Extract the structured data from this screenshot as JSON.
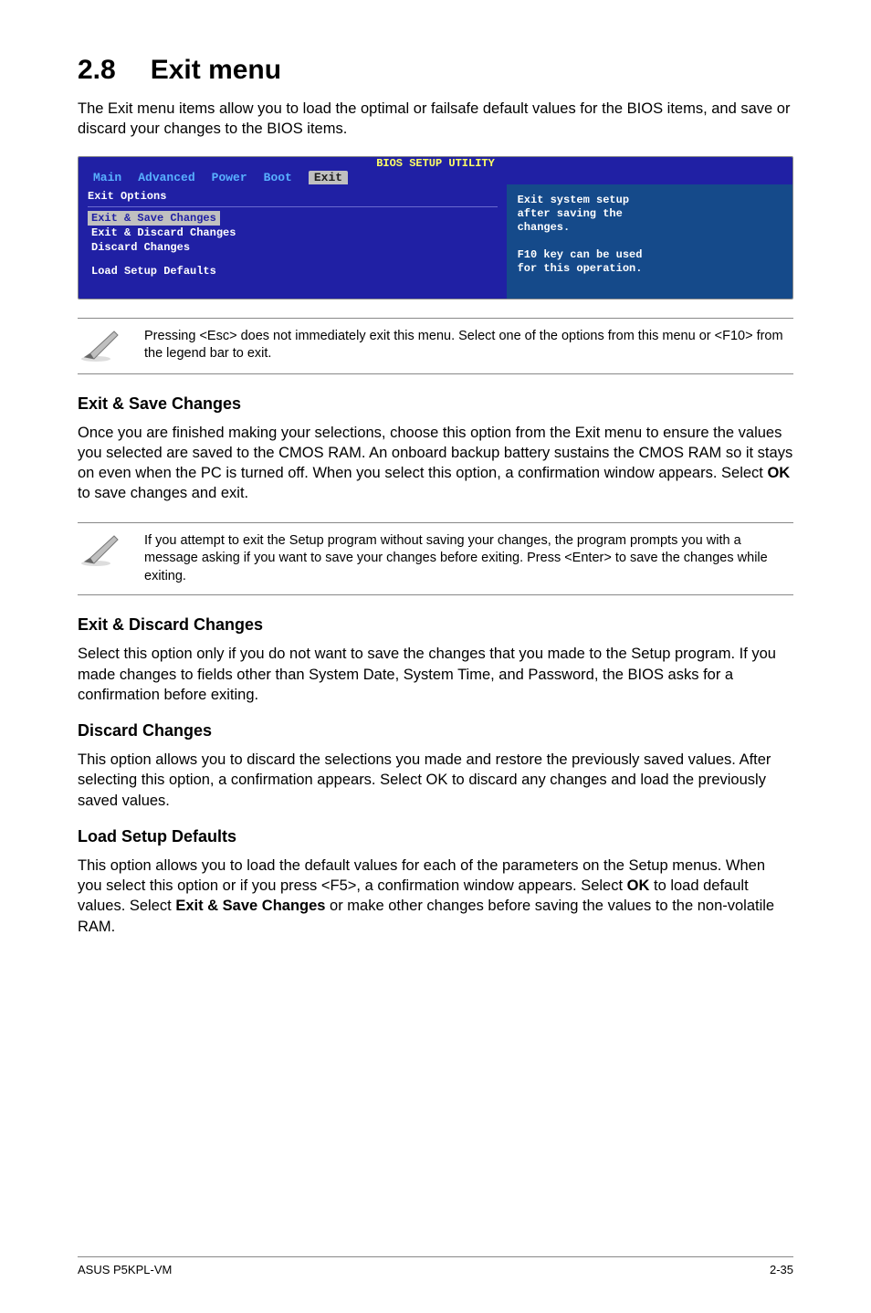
{
  "section_number": "2.8",
  "section_title": "Exit menu",
  "intro": "The Exit menu items allow you to load the optimal or failsafe default values for the BIOS items, and save or discard your changes to the BIOS items.",
  "bios": {
    "header_title": "BIOS SETUP UTILITY",
    "tabs": [
      "Main",
      "Advanced",
      "Power",
      "Boot",
      "Exit"
    ],
    "active_tab_index": 4,
    "left": {
      "group_label": "Exit Options",
      "selected": "Exit & Save Changes",
      "items": [
        "Exit & Discard Changes",
        "Discard Changes"
      ],
      "after_gap_item": "Load Setup Defaults"
    },
    "right_lines": [
      "Exit system setup",
      "after saving the",
      "changes.",
      "",
      "F10 key can be used",
      "for this operation."
    ]
  },
  "note1": "Pressing <Esc> does not immediately exit this menu. Select one of the options from this menu or <F10> from the legend bar to exit.",
  "sections": {
    "exit_save": {
      "heading": "Exit & Save Changes",
      "body_parts": [
        "Once you are finished making your selections, choose this option from the Exit menu to ensure the values you selected are saved to the CMOS RAM. An onboard backup battery sustains the CMOS RAM so it stays on even when the PC is turned off. When you select this option, a confirmation window appears. Select ",
        "OK",
        " to save changes and exit."
      ]
    },
    "note2": " If you attempt to exit the Setup program without saving your changes, the program prompts you with a message asking if you want to save your changes before exiting. Press <Enter>  to save the  changes while exiting.",
    "exit_discard": {
      "heading": "Exit & Discard Changes",
      "body": "Select this option only if you do not want to save the changes that you  made to the Setup program. If you made changes to fields other than System Date, System Time, and Password, the BIOS asks for a confirmation before exiting."
    },
    "discard": {
      "heading": "Discard Changes",
      "body_parts": [
        "This option allows you to discard the selections you made and restore the previously saved values. After selecting this option, a confirmation appears. Select ",
        "OK",
        " to discard any changes and load the previously saved values."
      ]
    },
    "load_defaults": {
      "heading": "Load Setup Defaults",
      "body_parts": [
        "This option allows you to load the default values for each of the parameters on the Setup menus. When you select this option or if you press <F5>, a confirmation window appears. Select ",
        "OK",
        " to load default values. Select ",
        "Exit & Save Changes",
        " or make other changes before saving the values to the non-volatile RAM."
      ]
    }
  },
  "footer": {
    "left": "ASUS P5KPL-VM",
    "right": "2-35"
  }
}
